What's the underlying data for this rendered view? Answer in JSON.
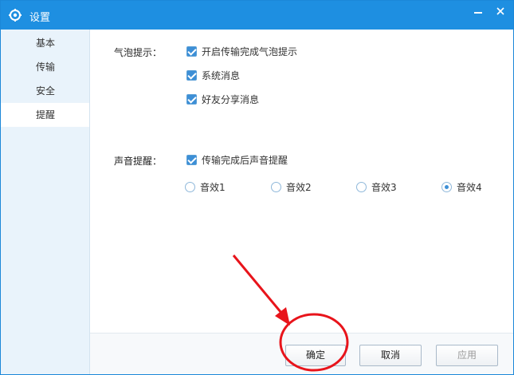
{
  "window": {
    "title": "设置"
  },
  "sidebar": {
    "items": [
      {
        "label": "基本"
      },
      {
        "label": "传输"
      },
      {
        "label": "安全"
      },
      {
        "label": "提醒"
      }
    ]
  },
  "bubble": {
    "label": "气泡提示：",
    "options": [
      {
        "label": "开启传输完成气泡提示",
        "checked": true
      },
      {
        "label": "系统消息",
        "checked": true
      },
      {
        "label": "好友分享消息",
        "checked": true
      }
    ]
  },
  "sound": {
    "label": "声音提醒：",
    "toggle": {
      "label": "传输完成后声音提醒",
      "checked": true
    },
    "effects": [
      {
        "label": "音效1",
        "selected": false
      },
      {
        "label": "音效2",
        "selected": false
      },
      {
        "label": "音效3",
        "selected": false
      },
      {
        "label": "音效4",
        "selected": true
      }
    ]
  },
  "footer": {
    "ok_label": "确定",
    "cancel_label": "取消",
    "apply_label": "应用"
  },
  "colors": {
    "titlebar": "#1e8fe1",
    "accent": "#3d8fd6",
    "annotation": "#e8141b"
  }
}
